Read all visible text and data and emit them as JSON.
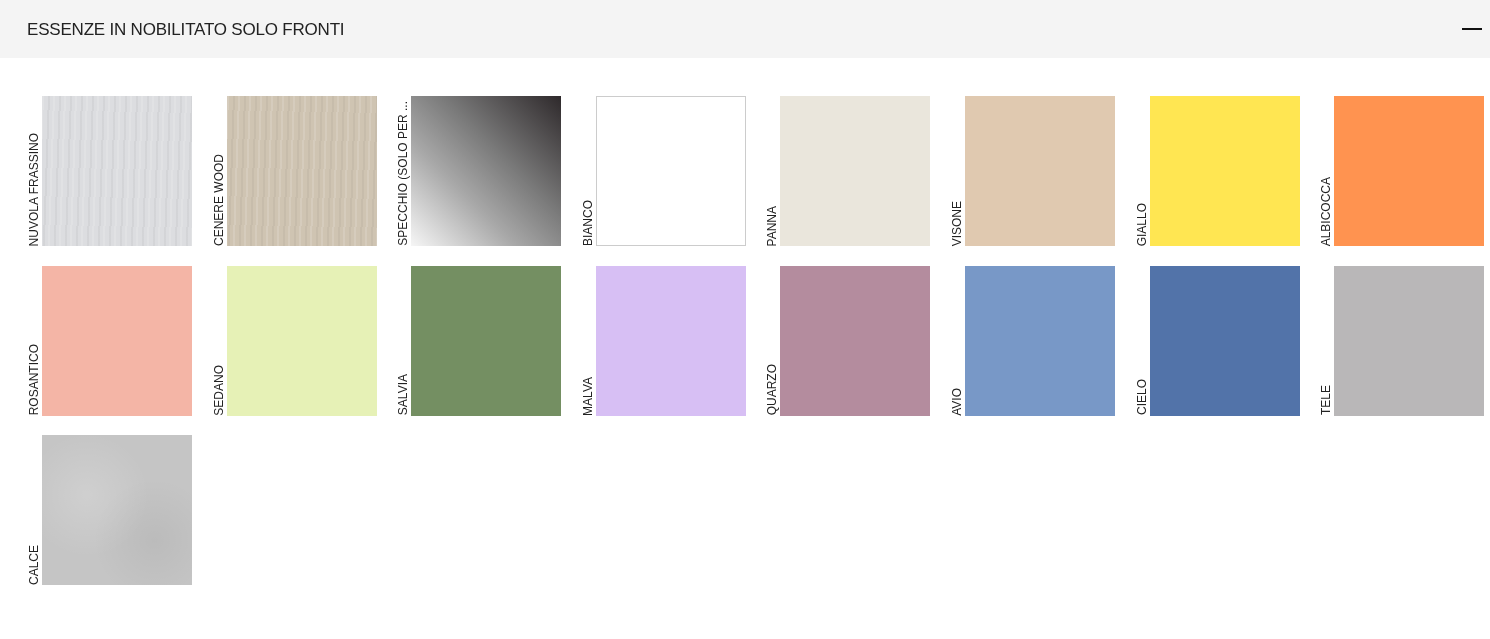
{
  "section": {
    "title": "ESSENZE IN NOBILITATO SOLO FRONTI",
    "expanded": true
  },
  "swatches": [
    {
      "label": "NUVOLA FRASSINO",
      "kind": "wood",
      "color": "#dcdde0"
    },
    {
      "label": "CENERE WOOD",
      "kind": "wood",
      "color": "#cfc4b2"
    },
    {
      "label": "SPECCHIO (SOLO PER ...",
      "kind": "mirror",
      "color": "#8c8c8c"
    },
    {
      "label": "BIANCO",
      "kind": "plain",
      "color": "#ffffff"
    },
    {
      "label": "PANNA",
      "kind": "plain",
      "color": "#eae6dc"
    },
    {
      "label": "VISONE",
      "kind": "plain",
      "color": "#e0c9b0"
    },
    {
      "label": "GIALLO",
      "kind": "plain",
      "color": "#ffe652"
    },
    {
      "label": "ALBICOCCA",
      "kind": "plain",
      "color": "#ff9350"
    },
    {
      "label": "ROSANTICO",
      "kind": "plain",
      "color": "#f4b5a6"
    },
    {
      "label": "SEDANO",
      "kind": "plain",
      "color": "#e6f1b6"
    },
    {
      "label": "SALVIA",
      "kind": "plain",
      "color": "#748f62"
    },
    {
      "label": "MALVA",
      "kind": "plain",
      "color": "#d7bff4"
    },
    {
      "label": "QUARZO",
      "kind": "plain",
      "color": "#b48c9e"
    },
    {
      "label": "AVIO",
      "kind": "plain",
      "color": "#7898c7"
    },
    {
      "label": "CIELO",
      "kind": "plain",
      "color": "#5273a9"
    },
    {
      "label": "TELE",
      "kind": "plain",
      "color": "#b9b7b8"
    },
    {
      "label": "CALCE",
      "kind": "stone",
      "color": "#c5c5c5"
    }
  ]
}
